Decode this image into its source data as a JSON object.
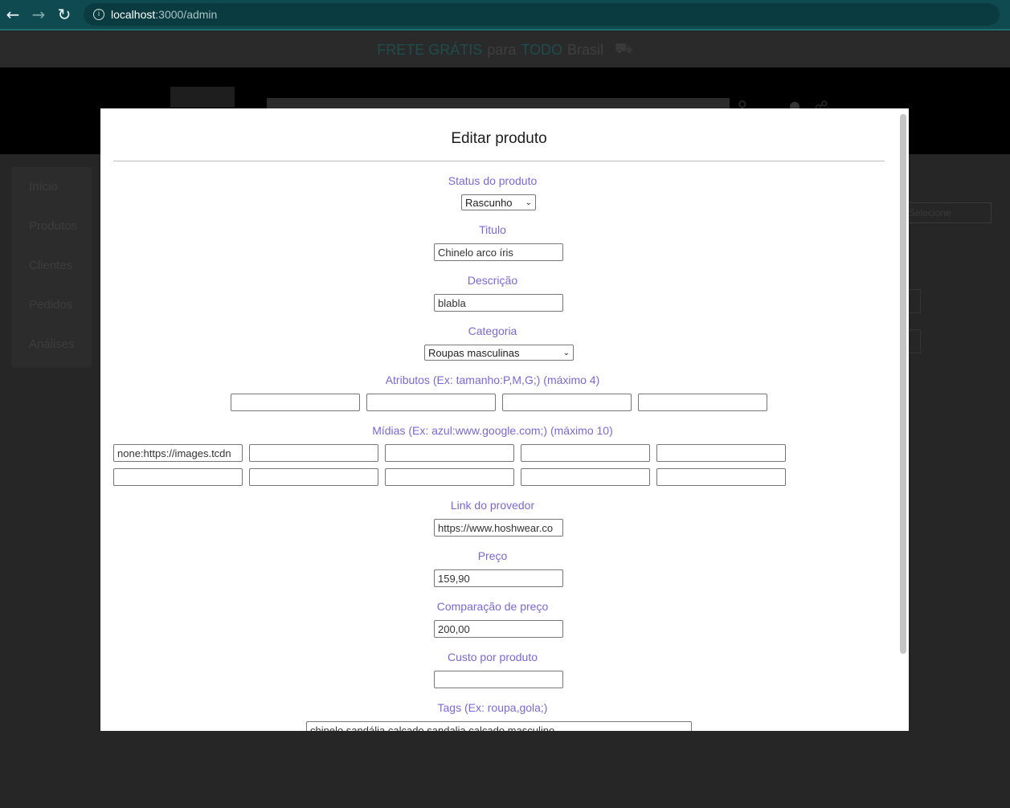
{
  "browser": {
    "url_host": "localhost",
    "url_path": ":3000/admin",
    "back_icon": "←",
    "forward_icon": "→",
    "reload_icon": "↻",
    "info_icon": "i"
  },
  "promo": {
    "part1": "FRETE GRÁTIS",
    "part2": "para",
    "part3": "TODO",
    "part4": "Brasil",
    "truck_icon": "⛟"
  },
  "admin_menu": [
    "Início",
    "Produtos",
    "Clientes",
    "Pedidos",
    "Análises"
  ],
  "background_select": "Selecione",
  "modal": {
    "title": "Editar produto",
    "status": {
      "label": "Status do produto",
      "value": "Rascunho"
    },
    "titulo": {
      "label": "Titulo",
      "value": "Chinelo arco íris"
    },
    "descricao": {
      "label": "Descrição",
      "value": "blabla"
    },
    "categoria": {
      "label": "Categoria",
      "value": "Roupas masculinas"
    },
    "atributos": {
      "label": "Atributos (Ex: tamanho:P,M,G;) (máximo 4)",
      "values": [
        "",
        "",
        "",
        ""
      ]
    },
    "midias": {
      "label": "Mídias (Ex: azul:www.google.com;) (máximo 10)",
      "values": [
        "none:https://images.tcdn",
        "",
        "",
        "",
        "",
        "",
        "",
        "",
        "",
        ""
      ]
    },
    "link": {
      "label": "Link do provedor",
      "value": "https://www.hoshwear.co"
    },
    "preco": {
      "label": "Preço",
      "value": "159,90"
    },
    "comparacao": {
      "label": "Comparação de preço",
      "value": "200,00"
    },
    "custo": {
      "label": "Custo por produto",
      "value": ""
    },
    "tags": {
      "label": "Tags (Ex: roupa,gola;)",
      "value": "chinelo,sandália,calcado,sandalia,calçado masculino"
    }
  },
  "colors": {
    "label_color": "#7b68d6",
    "browser_bar": "#0f4a50",
    "overlay_bg": "#262626"
  }
}
